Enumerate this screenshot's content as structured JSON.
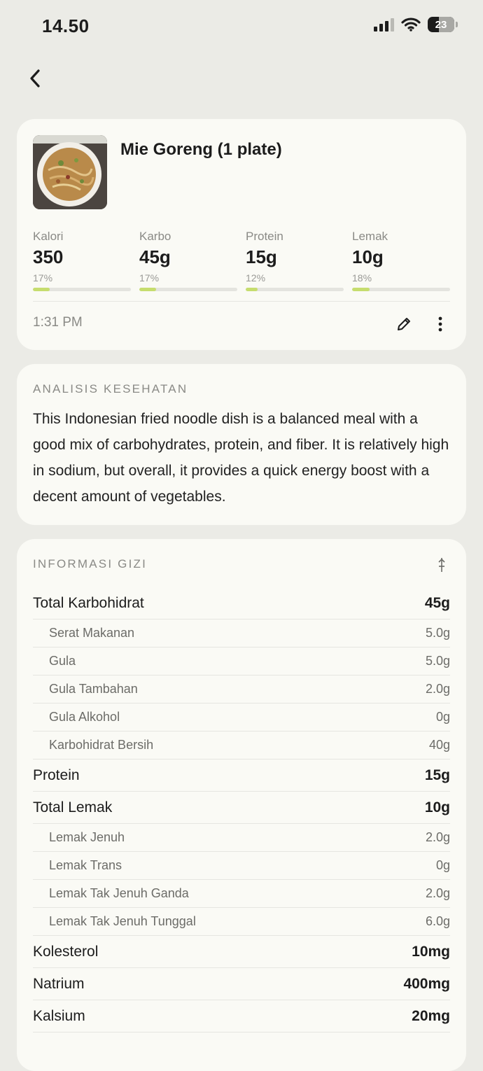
{
  "status": {
    "time": "14.50",
    "battery": "23"
  },
  "meal": {
    "title": "Mie Goreng (1 plate)",
    "time": "1:31 PM",
    "macros": [
      {
        "label": "Kalori",
        "value": "350",
        "pct": "17%",
        "fill": 0.17
      },
      {
        "label": "Karbo",
        "value": "45g",
        "pct": "17%",
        "fill": 0.17
      },
      {
        "label": "Protein",
        "value": "15g",
        "pct": "12%",
        "fill": 0.12
      },
      {
        "label": "Lemak",
        "value": "10g",
        "pct": "18%",
        "fill": 0.18
      }
    ]
  },
  "analysis": {
    "heading": "ANALISIS KESEHATAN",
    "text": "This Indonesian fried noodle dish is a balanced meal with a good mix of carbohydrates, protein, and fiber. It is relatively high in sodium, but overall, it provides a quick energy boost with a decent amount of vegetables."
  },
  "nutrition": {
    "heading": "INFORMASI GIZI",
    "rows": [
      {
        "label": "Total Karbohidrat",
        "value": "45g",
        "level": "main"
      },
      {
        "label": "Serat Makanan",
        "value": "5.0g",
        "level": "sub"
      },
      {
        "label": "Gula",
        "value": "5.0g",
        "level": "sub"
      },
      {
        "label": "Gula Tambahan",
        "value": "2.0g",
        "level": "sub"
      },
      {
        "label": "Gula Alkohol",
        "value": "0g",
        "level": "sub"
      },
      {
        "label": "Karbohidrat Bersih",
        "value": "40g",
        "level": "sub"
      },
      {
        "label": "Protein",
        "value": "15g",
        "level": "main"
      },
      {
        "label": "Total Lemak",
        "value": "10g",
        "level": "main"
      },
      {
        "label": "Lemak Jenuh",
        "value": "2.0g",
        "level": "sub"
      },
      {
        "label": "Lemak Trans",
        "value": "0g",
        "level": "sub"
      },
      {
        "label": "Lemak Tak Jenuh Ganda",
        "value": "2.0g",
        "level": "sub"
      },
      {
        "label": "Lemak Tak Jenuh Tunggal",
        "value": "6.0g",
        "level": "sub"
      },
      {
        "label": "Kolesterol",
        "value": "10mg",
        "level": "main"
      },
      {
        "label": "Natrium",
        "value": "400mg",
        "level": "main"
      },
      {
        "label": "Kalsium",
        "value": "20mg",
        "level": "main"
      }
    ]
  },
  "colors": {
    "accent": "#c6dd6e",
    "background": "#ebebe6",
    "card": "#fafaf5"
  },
  "icons": [
    "back-chevron-icon",
    "pencil-icon",
    "more-vertical-icon",
    "sort-icon",
    "wifi-icon",
    "signal-icon",
    "battery-icon"
  ]
}
